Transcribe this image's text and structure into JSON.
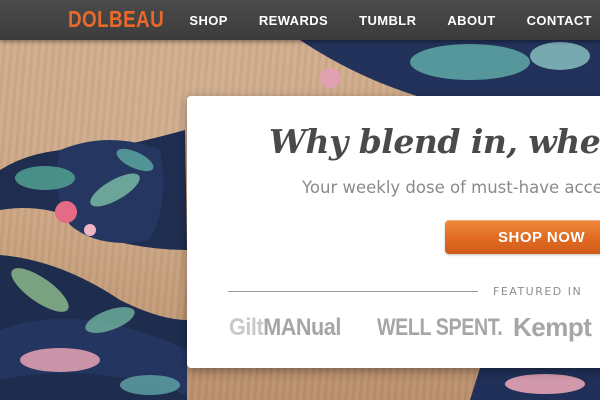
{
  "brand": {
    "logo_text": "DOLBEAU",
    "color": "#e8692a"
  },
  "nav": {
    "items": [
      {
        "label": "SHOP"
      },
      {
        "label": "REWARDS"
      },
      {
        "label": "TUMBLR"
      },
      {
        "label": "ABOUT"
      },
      {
        "label": "CONTACT"
      }
    ]
  },
  "hero": {
    "headline": "Why blend in, when you",
    "subhead": "Your weekly dose of must-have acce",
    "cta_label": "SHOP NOW",
    "cta_color": "#e06a22"
  },
  "featured": {
    "label": "FEATURED IN",
    "logos": [
      {
        "part1": "Gilt",
        "part2": "MANual"
      },
      {
        "text": "WELL SPENT."
      },
      {
        "text": "Kempt"
      }
    ]
  }
}
